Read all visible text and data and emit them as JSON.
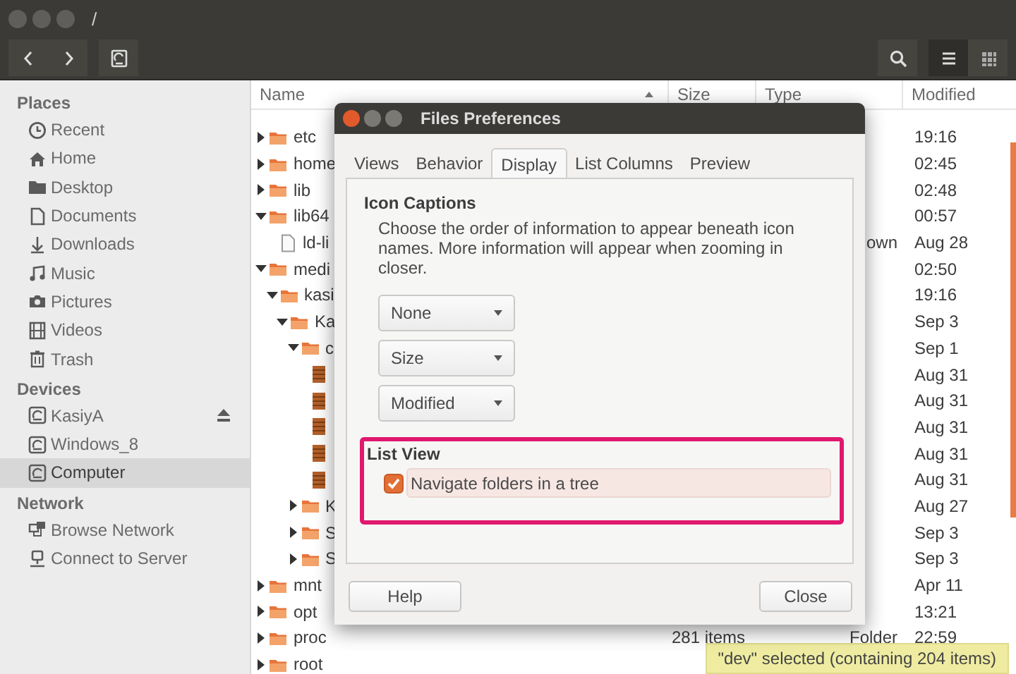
{
  "window": {
    "title": "/"
  },
  "toolbar": {
    "list_view_selected": true
  },
  "sidebar": {
    "sections": [
      {
        "title": "Places",
        "items": [
          {
            "label": "Recent",
            "selected": false
          },
          {
            "label": "Home",
            "selected": false
          },
          {
            "label": "Desktop",
            "selected": false
          },
          {
            "label": "Documents",
            "selected": false
          },
          {
            "label": "Downloads",
            "selected": false
          },
          {
            "label": "Music",
            "selected": false
          },
          {
            "label": "Pictures",
            "selected": false
          },
          {
            "label": "Videos",
            "selected": false
          },
          {
            "label": "Trash",
            "selected": false
          }
        ]
      },
      {
        "title": "Devices",
        "items": [
          {
            "label": "KasiyA",
            "selected": false,
            "ejectable": true
          },
          {
            "label": "Windows_8",
            "selected": false
          },
          {
            "label": "Computer",
            "selected": true
          }
        ]
      },
      {
        "title": "Network",
        "items": [
          {
            "label": "Browse Network",
            "selected": false
          },
          {
            "label": "Connect to Server",
            "selected": false
          }
        ]
      }
    ]
  },
  "table": {
    "columns": [
      "Name",
      "Size",
      "Type",
      "Modified"
    ],
    "rows": [
      {
        "kind": "folder",
        "name": "etc",
        "expanded": false,
        "modified": "19:16"
      },
      {
        "kind": "folder",
        "name": "home",
        "expanded": false,
        "modified": "02:45"
      },
      {
        "kind": "folder",
        "name": "lib",
        "expanded": false,
        "modified": "02:48"
      },
      {
        "kind": "folder",
        "name": "lib64",
        "expanded": true,
        "modified": "00:57",
        "children": [
          {
            "kind": "file",
            "name": "ld-li",
            "type": "own",
            "modified": "Aug 28"
          }
        ]
      },
      {
        "kind": "folder",
        "name": "medi",
        "expanded": true,
        "modified": "02:50",
        "children": [
          {
            "kind": "folder",
            "name": "kasi",
            "expanded": true,
            "modified": "19:16",
            "children": [
              {
                "kind": "folder",
                "name": "Ka",
                "expanded": true,
                "modified": "Sep 3",
                "children": [
                  {
                    "kind": "folder",
                    "name": "c",
                    "expanded": true,
                    "modified": "Sep 1",
                    "children": [
                      {
                        "kind": "video",
                        "modified": "Aug 31"
                      },
                      {
                        "kind": "video",
                        "modified": "Aug 31"
                      },
                      {
                        "kind": "video",
                        "modified": "Aug 31"
                      },
                      {
                        "kind": "video",
                        "modified": "Aug 31"
                      },
                      {
                        "kind": "video",
                        "modified": "Aug 31"
                      }
                    ]
                  },
                  {
                    "kind": "folder",
                    "name": "K",
                    "expanded": false,
                    "modified": "Aug 27"
                  },
                  {
                    "kind": "folder",
                    "name": "S",
                    "expanded": false,
                    "modified": "Sep 3"
                  },
                  {
                    "kind": "folder",
                    "name": "S",
                    "expanded": false,
                    "modified": "Sep 3"
                  }
                ]
              }
            ]
          }
        ]
      },
      {
        "kind": "folder",
        "name": "mnt",
        "expanded": false,
        "modified": "Apr 11"
      },
      {
        "kind": "folder",
        "name": "opt",
        "expanded": false,
        "modified": "13:21"
      },
      {
        "kind": "folder",
        "name": "proc",
        "expanded": false,
        "size": "281 items",
        "type": "Folder",
        "modified": "22:59"
      },
      {
        "kind": "folder",
        "name": "root",
        "expanded": false
      }
    ]
  },
  "status_bar": "\"dev\" selected  (containing 204 items)",
  "dialog": {
    "title": "Files Preferences",
    "tabs": [
      {
        "label": "Views",
        "selected": false
      },
      {
        "label": "Behavior",
        "selected": false
      },
      {
        "label": "Display",
        "selected": true
      },
      {
        "label": "List Columns",
        "selected": false
      },
      {
        "label": "Preview",
        "selected": false
      }
    ],
    "icon_captions": {
      "title": "Icon Captions",
      "description": "Choose the order of information to appear beneath icon names. More information will appear when zooming in closer.",
      "dropdowns": [
        "None",
        "Size",
        "Modified"
      ]
    },
    "list_view": {
      "title": "List View",
      "highlighted": true,
      "option": {
        "label": "Navigate folders in a tree",
        "checked": true
      }
    },
    "buttons": [
      "Help",
      "Close"
    ]
  }
}
